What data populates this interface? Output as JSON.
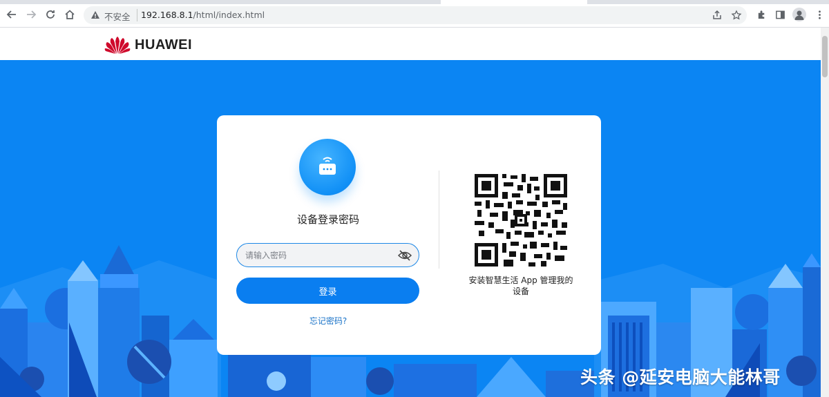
{
  "browser": {
    "security_label": "不安全",
    "url_host": "192.168.8.1",
    "url_path": "/html/index.html"
  },
  "header": {
    "brand": "HUAWEI",
    "brand_color": "#cf0a2c"
  },
  "login": {
    "title": "设备登录密码",
    "password_placeholder": "请输入密码",
    "login_button": "登录",
    "forgot_link": "忘记密码?"
  },
  "qr": {
    "caption": "安装智慧生活 App 管理我的设备"
  },
  "watermark": "头条 @延安电脑大能林哥",
  "colors": {
    "hero_blue": "#0b85f3",
    "accent": "#0a7ef0"
  }
}
